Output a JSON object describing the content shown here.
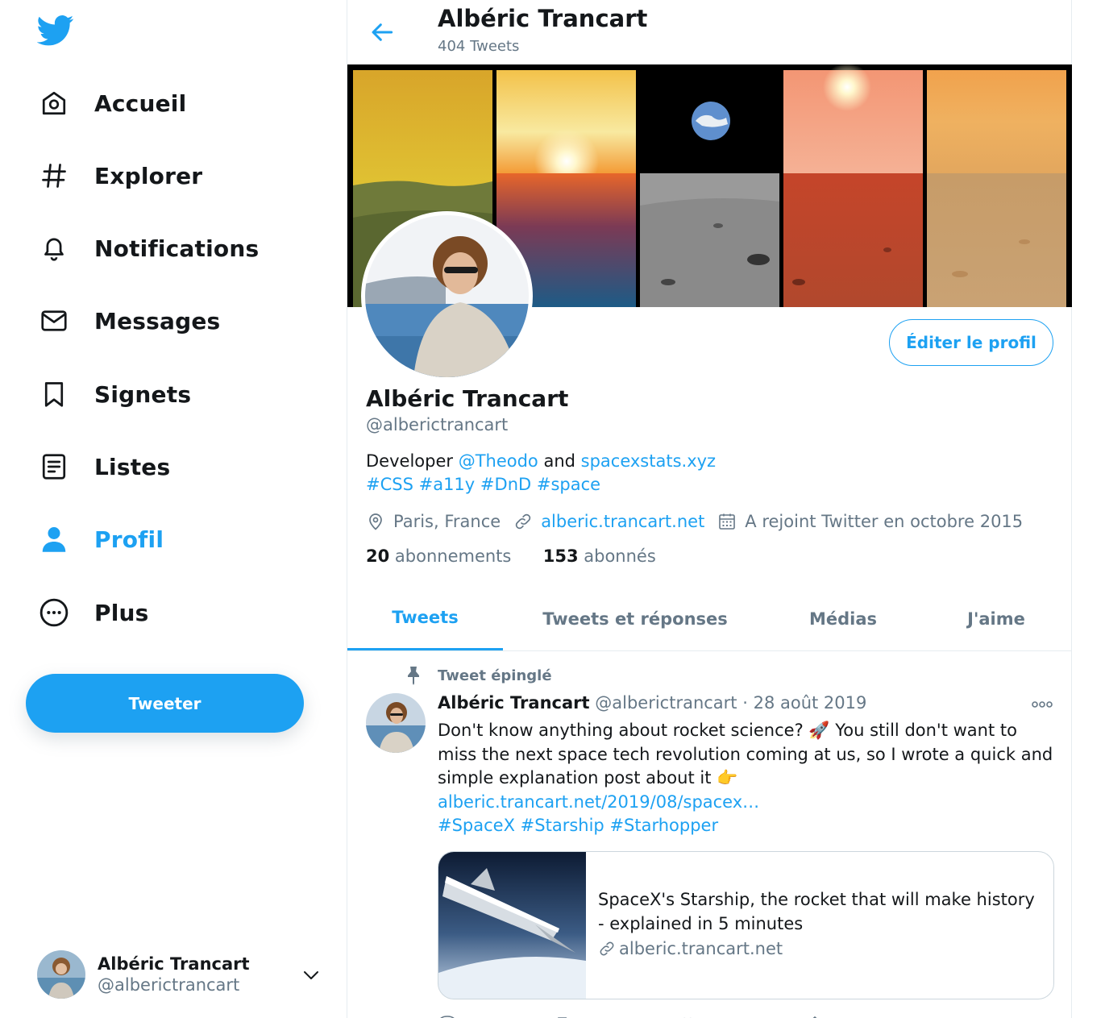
{
  "colors": {
    "accent": "#1da1f2",
    "text": "#14171a",
    "secondary": "#657786",
    "border": "#e6ecf0"
  },
  "sidebar": {
    "logo": "twitter-bird-icon",
    "items": [
      {
        "label": "Accueil",
        "icon": "home-icon"
      },
      {
        "label": "Explorer",
        "icon": "hashtag-icon"
      },
      {
        "label": "Notifications",
        "icon": "bell-icon"
      },
      {
        "label": "Messages",
        "icon": "envelope-icon"
      },
      {
        "label": "Signets",
        "icon": "bookmark-icon"
      },
      {
        "label": "Listes",
        "icon": "list-icon"
      },
      {
        "label": "Profil",
        "icon": "user-icon",
        "active": true
      },
      {
        "label": "Plus",
        "icon": "more-circle-icon"
      }
    ],
    "tweet_button": "Tweeter",
    "account": {
      "name": "Albéric Trancart",
      "handle": "@alberictrancart"
    }
  },
  "header": {
    "name": "Albéric Trancart",
    "tweet_count": "404 Tweets"
  },
  "profile": {
    "edit_button": "Éditer le profil",
    "name": "Albéric Trancart",
    "handle": "@alberictrancart",
    "bio": {
      "prefix": "Developer ",
      "mention": "@Theodo",
      "middle": " and ",
      "site": "spacexstats.xyz",
      "hashtags": [
        "#CSS",
        "#a11y",
        "#DnD",
        "#space"
      ]
    },
    "location": "Paris, France",
    "website": "alberic.trancart.net",
    "joined": "A rejoint Twitter en octobre 2015",
    "following_count": "20",
    "following_label": " abonnements",
    "followers_count": "153",
    "followers_label": " abonnés"
  },
  "tabs": [
    "Tweets",
    "Tweets et réponses",
    "Médias",
    "J'aime"
  ],
  "pinned_tweet": {
    "pinned_label": "Tweet épinglé",
    "author": "Albéric Trancart",
    "handle": "@alberictrancart",
    "separator": " · ",
    "date": "28 août 2019",
    "text1": "Don't know anything about rocket science? 🚀 You still don't want to miss the next space tech revolution coming at us, so I wrote a quick and simple explanation post about it 👉",
    "link": "alberic.trancart.net/2019/08/spacex…",
    "hashtags": [
      "#SpaceX",
      "#Starship",
      "#Starhopper"
    ],
    "card": {
      "title": "SpaceX's Starship, the rocket that will make history - explained in 5 minutes",
      "domain": "alberic.trancart.net"
    }
  }
}
